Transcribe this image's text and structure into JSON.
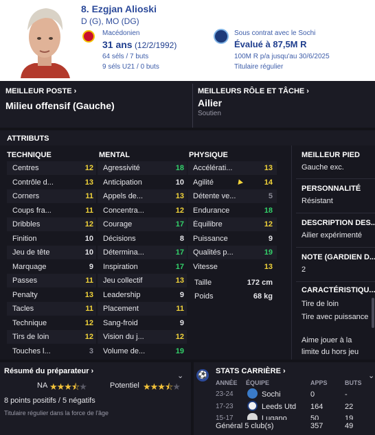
{
  "player": {
    "name": "8. Ezgjan Alioski",
    "positions": "D (G), MO (DG)",
    "nationality": "Macédonien",
    "age": "31 ans",
    "birth": "(12/2/1992)",
    "caps": "64 séls / 7 buts",
    "u21": "9 séls U21 / 0 buts",
    "contract": "Sous contrat avec le Sochi",
    "value": "Évalué à 87,5M R",
    "wage": "100M R p/a jusqu'au 30/6/2025",
    "status": "Titulaire régulier"
  },
  "best_position": {
    "title": "MEILLEUR POSTE",
    "value": "Milieu offensif (Gauche)"
  },
  "best_role": {
    "title": "MEILLEURS RÔLE ET TÂCHE",
    "value": "Ailier",
    "duty": "Soutien"
  },
  "attributes": {
    "title": "ATTRIBUTS",
    "technique": {
      "title": "TECHNIQUE",
      "rows": [
        {
          "label": "Centres",
          "value": "12",
          "c": "yellow"
        },
        {
          "label": "Contrôle d...",
          "value": "13",
          "c": "yellow"
        },
        {
          "label": "Corners",
          "value": "11",
          "c": "yellow"
        },
        {
          "label": "Coups fra...",
          "value": "11",
          "c": "yellow"
        },
        {
          "label": "Dribbles",
          "value": "12",
          "c": "yellow"
        },
        {
          "label": "Finition",
          "value": "10",
          "c": "white"
        },
        {
          "label": "Jeu de tête",
          "value": "10",
          "c": "white"
        },
        {
          "label": "Marquage",
          "value": "9",
          "c": "white"
        },
        {
          "label": "Passes",
          "value": "11",
          "c": "yellow"
        },
        {
          "label": "Penalty",
          "value": "13",
          "c": "yellow"
        },
        {
          "label": "Tacles",
          "value": "11",
          "c": "yellow"
        },
        {
          "label": "Technique",
          "value": "12",
          "c": "yellow"
        },
        {
          "label": "Tirs de loin",
          "value": "12",
          "c": "yellow"
        },
        {
          "label": "Touches l...",
          "value": "3",
          "c": "grey"
        }
      ]
    },
    "mental": {
      "title": "MENTAL",
      "rows": [
        {
          "label": "Agressivité",
          "value": "18",
          "c": "green"
        },
        {
          "label": "Anticipation",
          "value": "10",
          "c": "white"
        },
        {
          "label": "Appels de...",
          "value": "13",
          "c": "yellow"
        },
        {
          "label": "Concentra...",
          "value": "12",
          "c": "yellow"
        },
        {
          "label": "Courage",
          "value": "17",
          "c": "green"
        },
        {
          "label": "Décisions",
          "value": "8",
          "c": "white"
        },
        {
          "label": "Détermina...",
          "value": "17",
          "c": "green"
        },
        {
          "label": "Inspiration",
          "value": "17",
          "c": "green"
        },
        {
          "label": "Jeu collectif",
          "value": "13",
          "c": "yellow"
        },
        {
          "label": "Leadership",
          "value": "9",
          "c": "white"
        },
        {
          "label": "Placement",
          "value": "11",
          "c": "yellow"
        },
        {
          "label": "Sang-froid",
          "value": "9",
          "c": "white"
        },
        {
          "label": "Vision du j...",
          "value": "12",
          "c": "yellow"
        },
        {
          "label": "Volume de...",
          "value": "19",
          "c": "green"
        }
      ]
    },
    "physique": {
      "title": "PHYSIQUE",
      "rows": [
        {
          "label": "Accélérati...",
          "value": "13",
          "c": "yellow"
        },
        {
          "label": "Agilité",
          "value": "14",
          "c": "yellow"
        },
        {
          "label": "Détente ve...",
          "value": "5",
          "c": "grey"
        },
        {
          "label": "Endurance",
          "value": "18",
          "c": "green"
        },
        {
          "label": "Équilibre",
          "value": "12",
          "c": "yellow"
        },
        {
          "label": "Puissance",
          "value": "9",
          "c": "white"
        },
        {
          "label": "Qualités p...",
          "value": "19",
          "c": "green"
        },
        {
          "label": "Vitesse",
          "value": "13",
          "c": "yellow"
        }
      ],
      "height_label": "Taille",
      "height": "172 cm",
      "weight_label": "Poids",
      "weight": "68 kg"
    }
  },
  "side": {
    "best_foot_title": "MEILLEUR PIED",
    "best_foot": "Gauche exc.",
    "personality_title": "PERSONNALITÉ",
    "personality": "Résistant",
    "description_title": "DESCRIPTION DES...",
    "description": "Ailier expérimenté",
    "gk_title": "NOTE (GARDIEN D...",
    "gk": "2",
    "traits_title": "CARACTÉRISTIQU...",
    "traits": [
      "Tire de loin",
      "Tire avec puissance",
      "Aime jouer à la limite du hors jeu"
    ]
  },
  "scout": {
    "title": "Résumé du préparateur",
    "na_label": "NA",
    "pot_label": "Potentiel",
    "na_stars": 3.5,
    "pot_stars": 3.5,
    "points": "8 points positifs / 5 négatifs",
    "note": "Titulaire régulier dans la force de l'âge"
  },
  "career": {
    "title": "STATS CARRIÈRE",
    "headers": {
      "season": "ANNÉE",
      "team": "ÉQUIPE",
      "apps": "APPS",
      "goals": "BUTS"
    },
    "rows": [
      {
        "season": "23-24",
        "team": "Sochi",
        "apps": "0",
        "goals": "-"
      },
      {
        "season": "17-23",
        "team": "Leeds Utd",
        "apps": "164",
        "goals": "22"
      },
      {
        "season": "15-17",
        "team": "Lugano",
        "apps": "50",
        "goals": "19"
      }
    ],
    "total_label": "Général 5 club(s)",
    "total_apps": "357",
    "total_goals": "49"
  },
  "colors": {
    "accent": "#2c4a9a",
    "yellow": "#f2d43a",
    "green": "#33d16a"
  }
}
